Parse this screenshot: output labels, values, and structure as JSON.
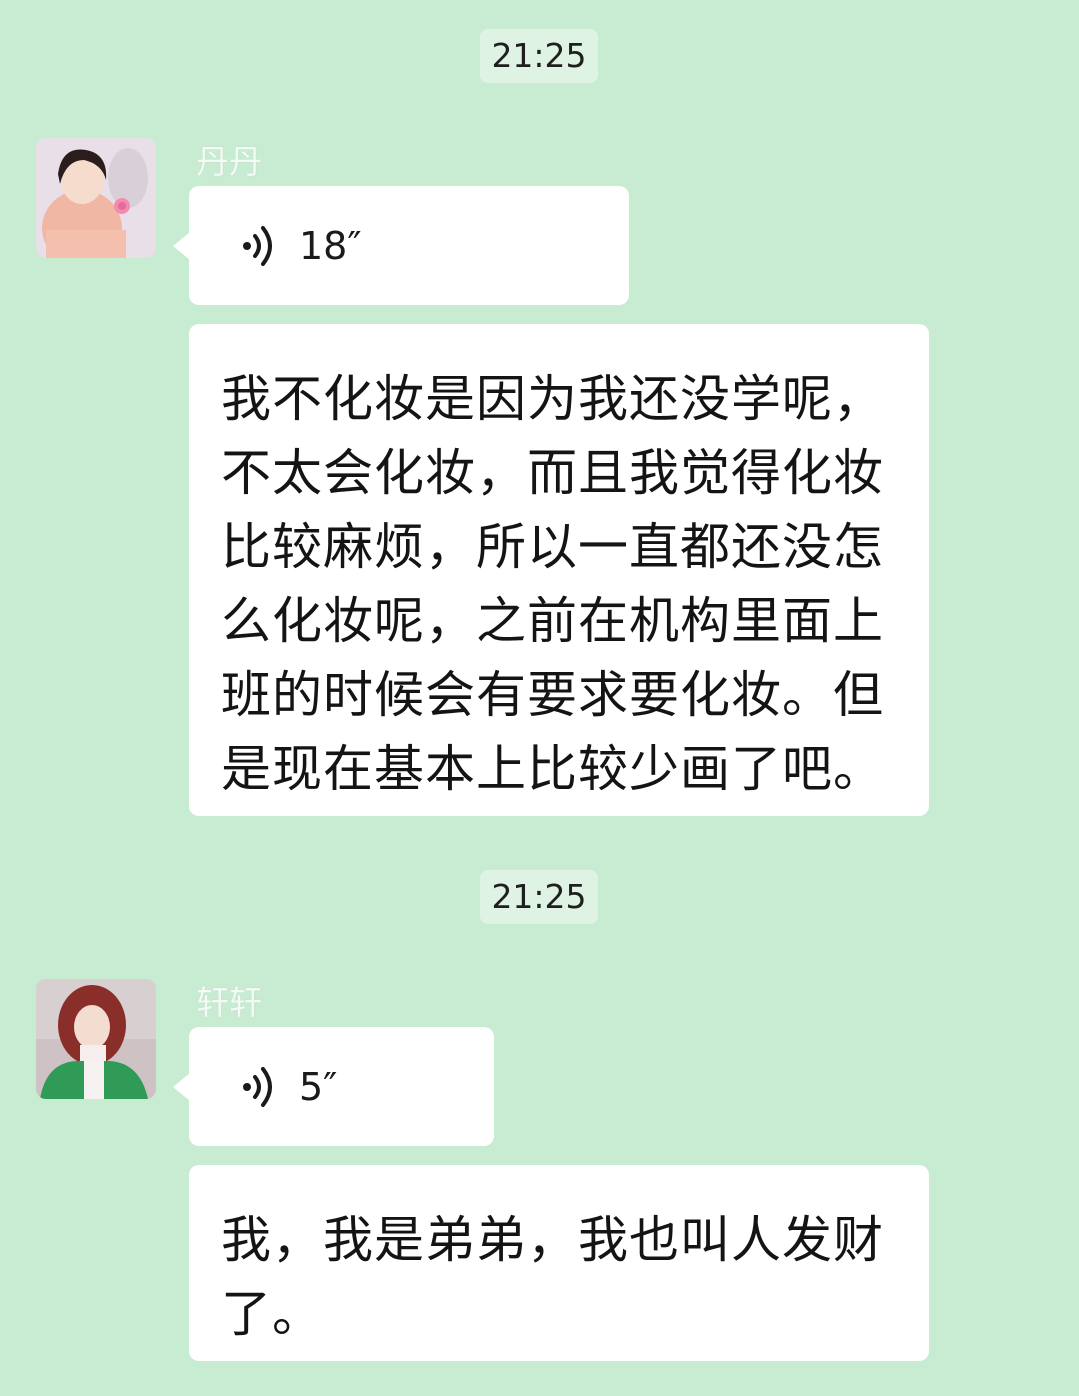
{
  "colors": {
    "background": "#c8ecd2",
    "bubble": "#ffffff",
    "time_badge": "#dff3e4",
    "name_text": "#f4fbf6"
  },
  "groups": [
    {
      "time": "21:25",
      "sender": {
        "name": "丹丹",
        "avatar_icon": "portrait-photo-woman-pink-dress"
      },
      "voice": {
        "icon": "voice-wave-icon",
        "duration": "18″"
      },
      "text": "我不化妆是因为我还没学呢，\n不太会化妆，而且我觉得化妆\n比较麻烦，所以一直都还没怎\n么化妆呢，之前在机构里面上\n班的时候会有要求要化妆。但\n是现在基本上比较少画了吧。"
    },
    {
      "time": "21:25",
      "sender": {
        "name": "轩轩",
        "avatar_icon": "portrait-photo-woman-green-jacket"
      },
      "voice": {
        "icon": "voice-wave-icon",
        "duration": "5″"
      },
      "text": "我，我是弟弟，我也叫人发财\n了。"
    }
  ]
}
